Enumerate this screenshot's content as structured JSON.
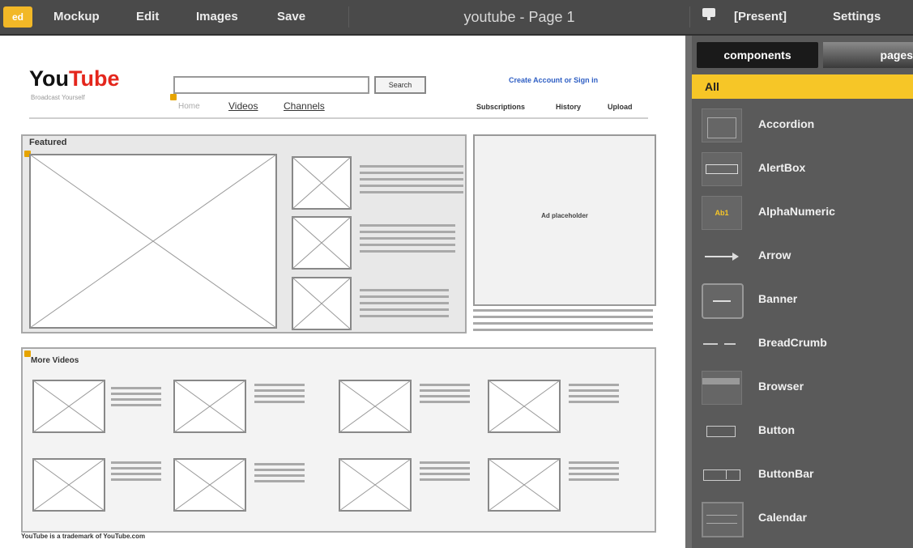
{
  "menubar": {
    "logo": "ed",
    "items": [
      "Mockup",
      "Edit",
      "Images",
      "Save"
    ],
    "title": "youtube - Page 1",
    "present": "[Present]",
    "settings": "Settings"
  },
  "mockup": {
    "logo_you": "You",
    "logo_tube": "Tube",
    "tagline": "Broadcast Yourself",
    "search_button": "Search",
    "account_link": "Create Account or Sign in",
    "nav": [
      "Home",
      "Videos",
      "Channels"
    ],
    "right_links": [
      "Subscriptions",
      "History",
      "Upload"
    ],
    "featured_label": "Featured",
    "ad_text": "Ad placeholder",
    "more_label": "More Videos",
    "footer": "YouTube is a trademark of YouTube.com"
  },
  "panel": {
    "tabs": [
      "components",
      "pages"
    ],
    "filter": "All",
    "components": [
      {
        "name": "Accordion",
        "icon": "accordion-icon"
      },
      {
        "name": "AlertBox",
        "icon": "alertbox-icon"
      },
      {
        "name": "AlphaNumeric",
        "icon": "alphanumeric-icon"
      },
      {
        "name": "Arrow",
        "icon": "arrow-icon"
      },
      {
        "name": "Banner",
        "icon": "banner-icon"
      },
      {
        "name": "BreadCrumb",
        "icon": "breadcrumb-icon"
      },
      {
        "name": "Browser",
        "icon": "browser-icon"
      },
      {
        "name": "Button",
        "icon": "button-icon"
      },
      {
        "name": "ButtonBar",
        "icon": "buttonbar-icon"
      },
      {
        "name": "Calendar",
        "icon": "calendar-icon"
      }
    ]
  },
  "colors": {
    "accent": "#f6c627",
    "menubar": "#4a4a4a",
    "panel": "#5a5a5a",
    "logo_red": "#e4261c"
  }
}
